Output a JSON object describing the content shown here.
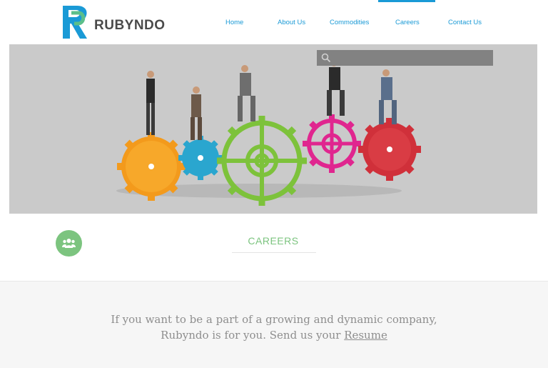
{
  "brand": {
    "name": "RUBYNDO"
  },
  "nav": {
    "items": [
      {
        "label": "Home"
      },
      {
        "label": "About Us"
      },
      {
        "label": "Commodities"
      },
      {
        "label": "Careers"
      },
      {
        "label": "Contact Us"
      }
    ],
    "active": "Careers"
  },
  "banner": {
    "search": {
      "placeholder": "",
      "icon": "search-icon"
    },
    "illustration": "businessmen-walking-on-gears"
  },
  "careers": {
    "title": "CAREERS",
    "badge_icon": "group-icon",
    "message": {
      "line1": "If you want to be a part of a growing and dynamic company,",
      "line2_prefix": "Rubyndo is for you. Send us your",
      "link": "Resume"
    }
  },
  "colors": {
    "accent": "#1a9ad6",
    "green": "#7cc47f",
    "gear_orange": "#f39a1c",
    "gear_blue": "#2aa6cf",
    "gear_green": "#7dc23b",
    "gear_magenta": "#e0268f",
    "gear_red": "#d0303a"
  }
}
